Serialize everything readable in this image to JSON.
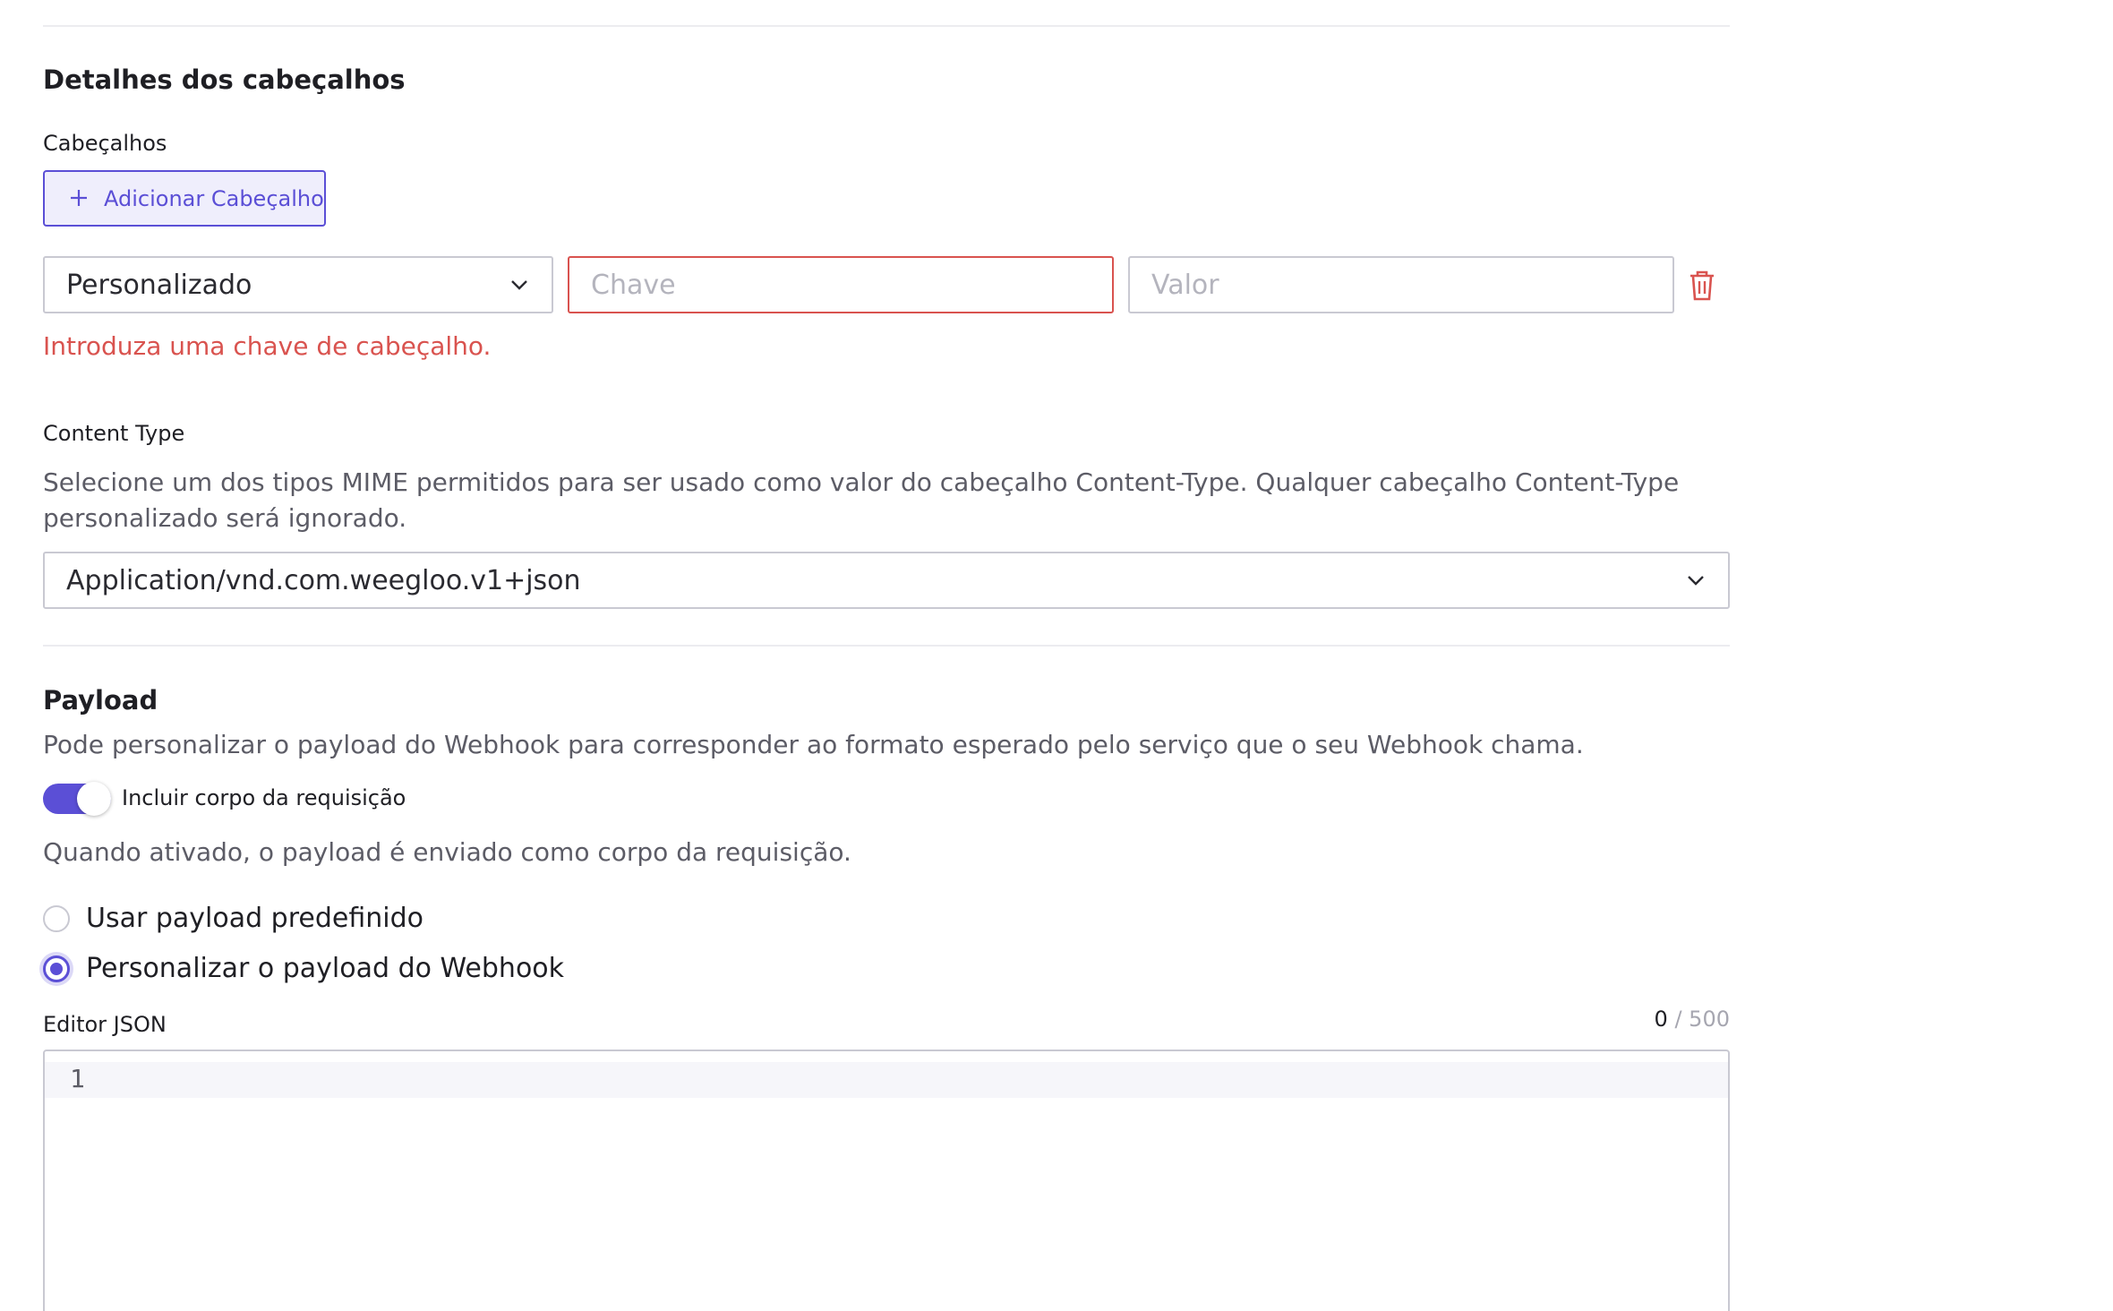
{
  "headers_section": {
    "title": "Detalhes dos cabeçalhos",
    "label": "Cabeçalhos",
    "add_button": "Adicionar Cabeçalho",
    "row": {
      "type_select_value": "Personalizado",
      "key_placeholder": "Chave",
      "value_placeholder": "Valor"
    },
    "key_error": "Introduza uma chave de cabeçalho."
  },
  "content_type": {
    "label": "Content Type",
    "help_line1": "Selecione um dos tipos MIME permitidos para ser usado como valor do cabeçalho Content-Type. Qualquer cabeçalho Content-Type",
    "help_line2": "personalizado será ignorado.",
    "selected": "Application/vnd.com.weegloo.v1+json"
  },
  "payload": {
    "title": "Payload",
    "description": "Pode personalizar o payload do Webhook para corresponder ao formato esperado pelo serviço que o seu Webhook chama.",
    "toggle_label": "Incluir corpo da requisição",
    "toggle_on": true,
    "toggle_help": "Quando ativado, o payload é enviado como corpo da requisição.",
    "options": [
      {
        "label": "Usar payload predefinido",
        "checked": false
      },
      {
        "label": "Personalizar o payload do Webhook",
        "checked": true
      }
    ],
    "editor_label": "Editor JSON",
    "char_count": "0",
    "char_max": "/ 500",
    "line_number": "1"
  },
  "colors": {
    "accent": "#5b4fd6",
    "error": "#d9534f",
    "border": "#c9c9d2"
  },
  "icons": {
    "add": "plus-icon",
    "select": "chevron-down-icon",
    "delete": "trash-icon"
  }
}
